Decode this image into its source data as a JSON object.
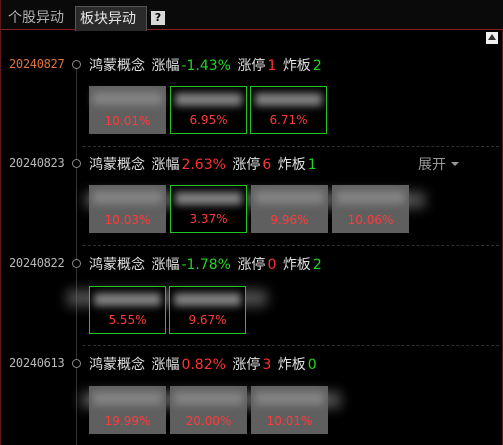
{
  "tabs": [
    {
      "label": "个股异动"
    },
    {
      "label": "板块异动"
    }
  ],
  "help_label": "?",
  "labels": {
    "change": "涨幅",
    "limit_up": "涨停",
    "broken": "炸板",
    "expand": "展开"
  },
  "events": [
    {
      "date": "20240827",
      "sector": "鸿蒙概念",
      "change": "-1.43%",
      "limit_up": "1",
      "broken": "2",
      "stocks": [
        {
          "pct": "10.01%"
        },
        {
          "pct": "6.95%"
        },
        {
          "pct": "6.71%"
        }
      ]
    },
    {
      "date": "20240823",
      "sector": "鸿蒙概念",
      "change": "2.63%",
      "limit_up": "6",
      "broken": "1",
      "stocks": [
        {
          "pct": "10.03%"
        },
        {
          "pct": "3.37%"
        },
        {
          "pct": "9.96%"
        },
        {
          "pct": "10.06%"
        }
      ]
    },
    {
      "date": "20240822",
      "sector": "鸿蒙概念",
      "change": "-1.78%",
      "limit_up": "0",
      "broken": "2",
      "stocks": [
        {
          "pct": "5.55%"
        },
        {
          "pct": "9.67%"
        }
      ]
    },
    {
      "date": "20240613",
      "sector": "鸿蒙概念",
      "change": "0.82%",
      "limit_up": "3",
      "broken": "0",
      "stocks": [
        {
          "pct": "19.99%"
        },
        {
          "pct": "20.00%"
        },
        {
          "pct": "10.01%"
        }
      ]
    }
  ],
  "colors": {
    "up": "#ff3232",
    "down": "#22d422",
    "accent_date": "#e0743a",
    "border": "#8a1c1c"
  }
}
